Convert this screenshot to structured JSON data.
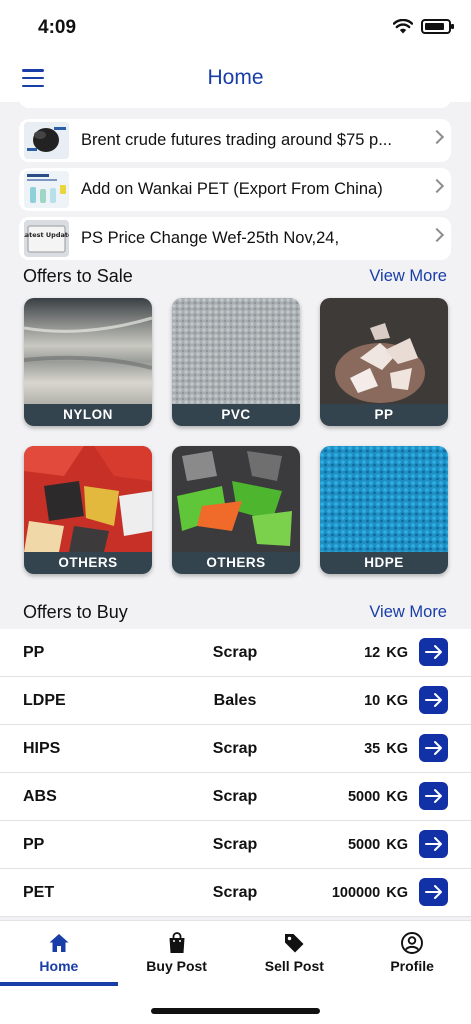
{
  "status_bar": {
    "time": "4:09",
    "wifi_icon": "wifi-icon",
    "battery_icon": "battery-icon"
  },
  "header": {
    "title": "Home",
    "menu_icon": "hamburger-menu-icon"
  },
  "news": [
    {
      "text": "Brent crude futures trading around $75 p...",
      "thumb_icon": "oil-barrel-thumbnail"
    },
    {
      "text": "Add on Wankai PET (Export From China)",
      "thumb_icon": "pet-bottle-thumbnail"
    },
    {
      "text": "PS Price Change Wef-25th Nov,24,",
      "thumb_icon": "latest-update-thumbnail",
      "thumb_caption": "Latest Update"
    }
  ],
  "offers_to_sale": {
    "title": "Offers to Sale",
    "view_more": "View More",
    "items": [
      {
        "label": "NYLON"
      },
      {
        "label": "PVC"
      },
      {
        "label": "PP"
      },
      {
        "label": "OTHERS"
      },
      {
        "label": "OTHERS"
      },
      {
        "label": "HDPE"
      }
    ]
  },
  "offers_to_buy": {
    "title": "Offers to Buy",
    "view_more": "View More",
    "rows": [
      {
        "material": "PP",
        "type": "Scrap",
        "qty": "12",
        "unit": "KG"
      },
      {
        "material": "LDPE",
        "type": "Bales",
        "qty": "10",
        "unit": "KG"
      },
      {
        "material": "HIPS",
        "type": "Scrap",
        "qty": "35",
        "unit": "KG"
      },
      {
        "material": "ABS",
        "type": "Scrap",
        "qty": "5000",
        "unit": "KG"
      },
      {
        "material": "PP",
        "type": "Scrap",
        "qty": "5000",
        "unit": "KG"
      },
      {
        "material": "PET",
        "type": "Scrap",
        "qty": "100000",
        "unit": "KG"
      }
    ]
  },
  "bottom_nav": [
    {
      "label": "Home",
      "icon": "home-icon",
      "active": true
    },
    {
      "label": "Buy Post",
      "icon": "shopping-bag-icon",
      "active": false
    },
    {
      "label": "Sell Post",
      "icon": "tag-icon",
      "active": false
    },
    {
      "label": "Profile",
      "icon": "user-circle-icon",
      "active": false
    }
  ],
  "colors": {
    "accent": "#1a3ea8",
    "button": "#1231a6",
    "label_bg": "#33444f",
    "background": "#f2f2f4"
  }
}
